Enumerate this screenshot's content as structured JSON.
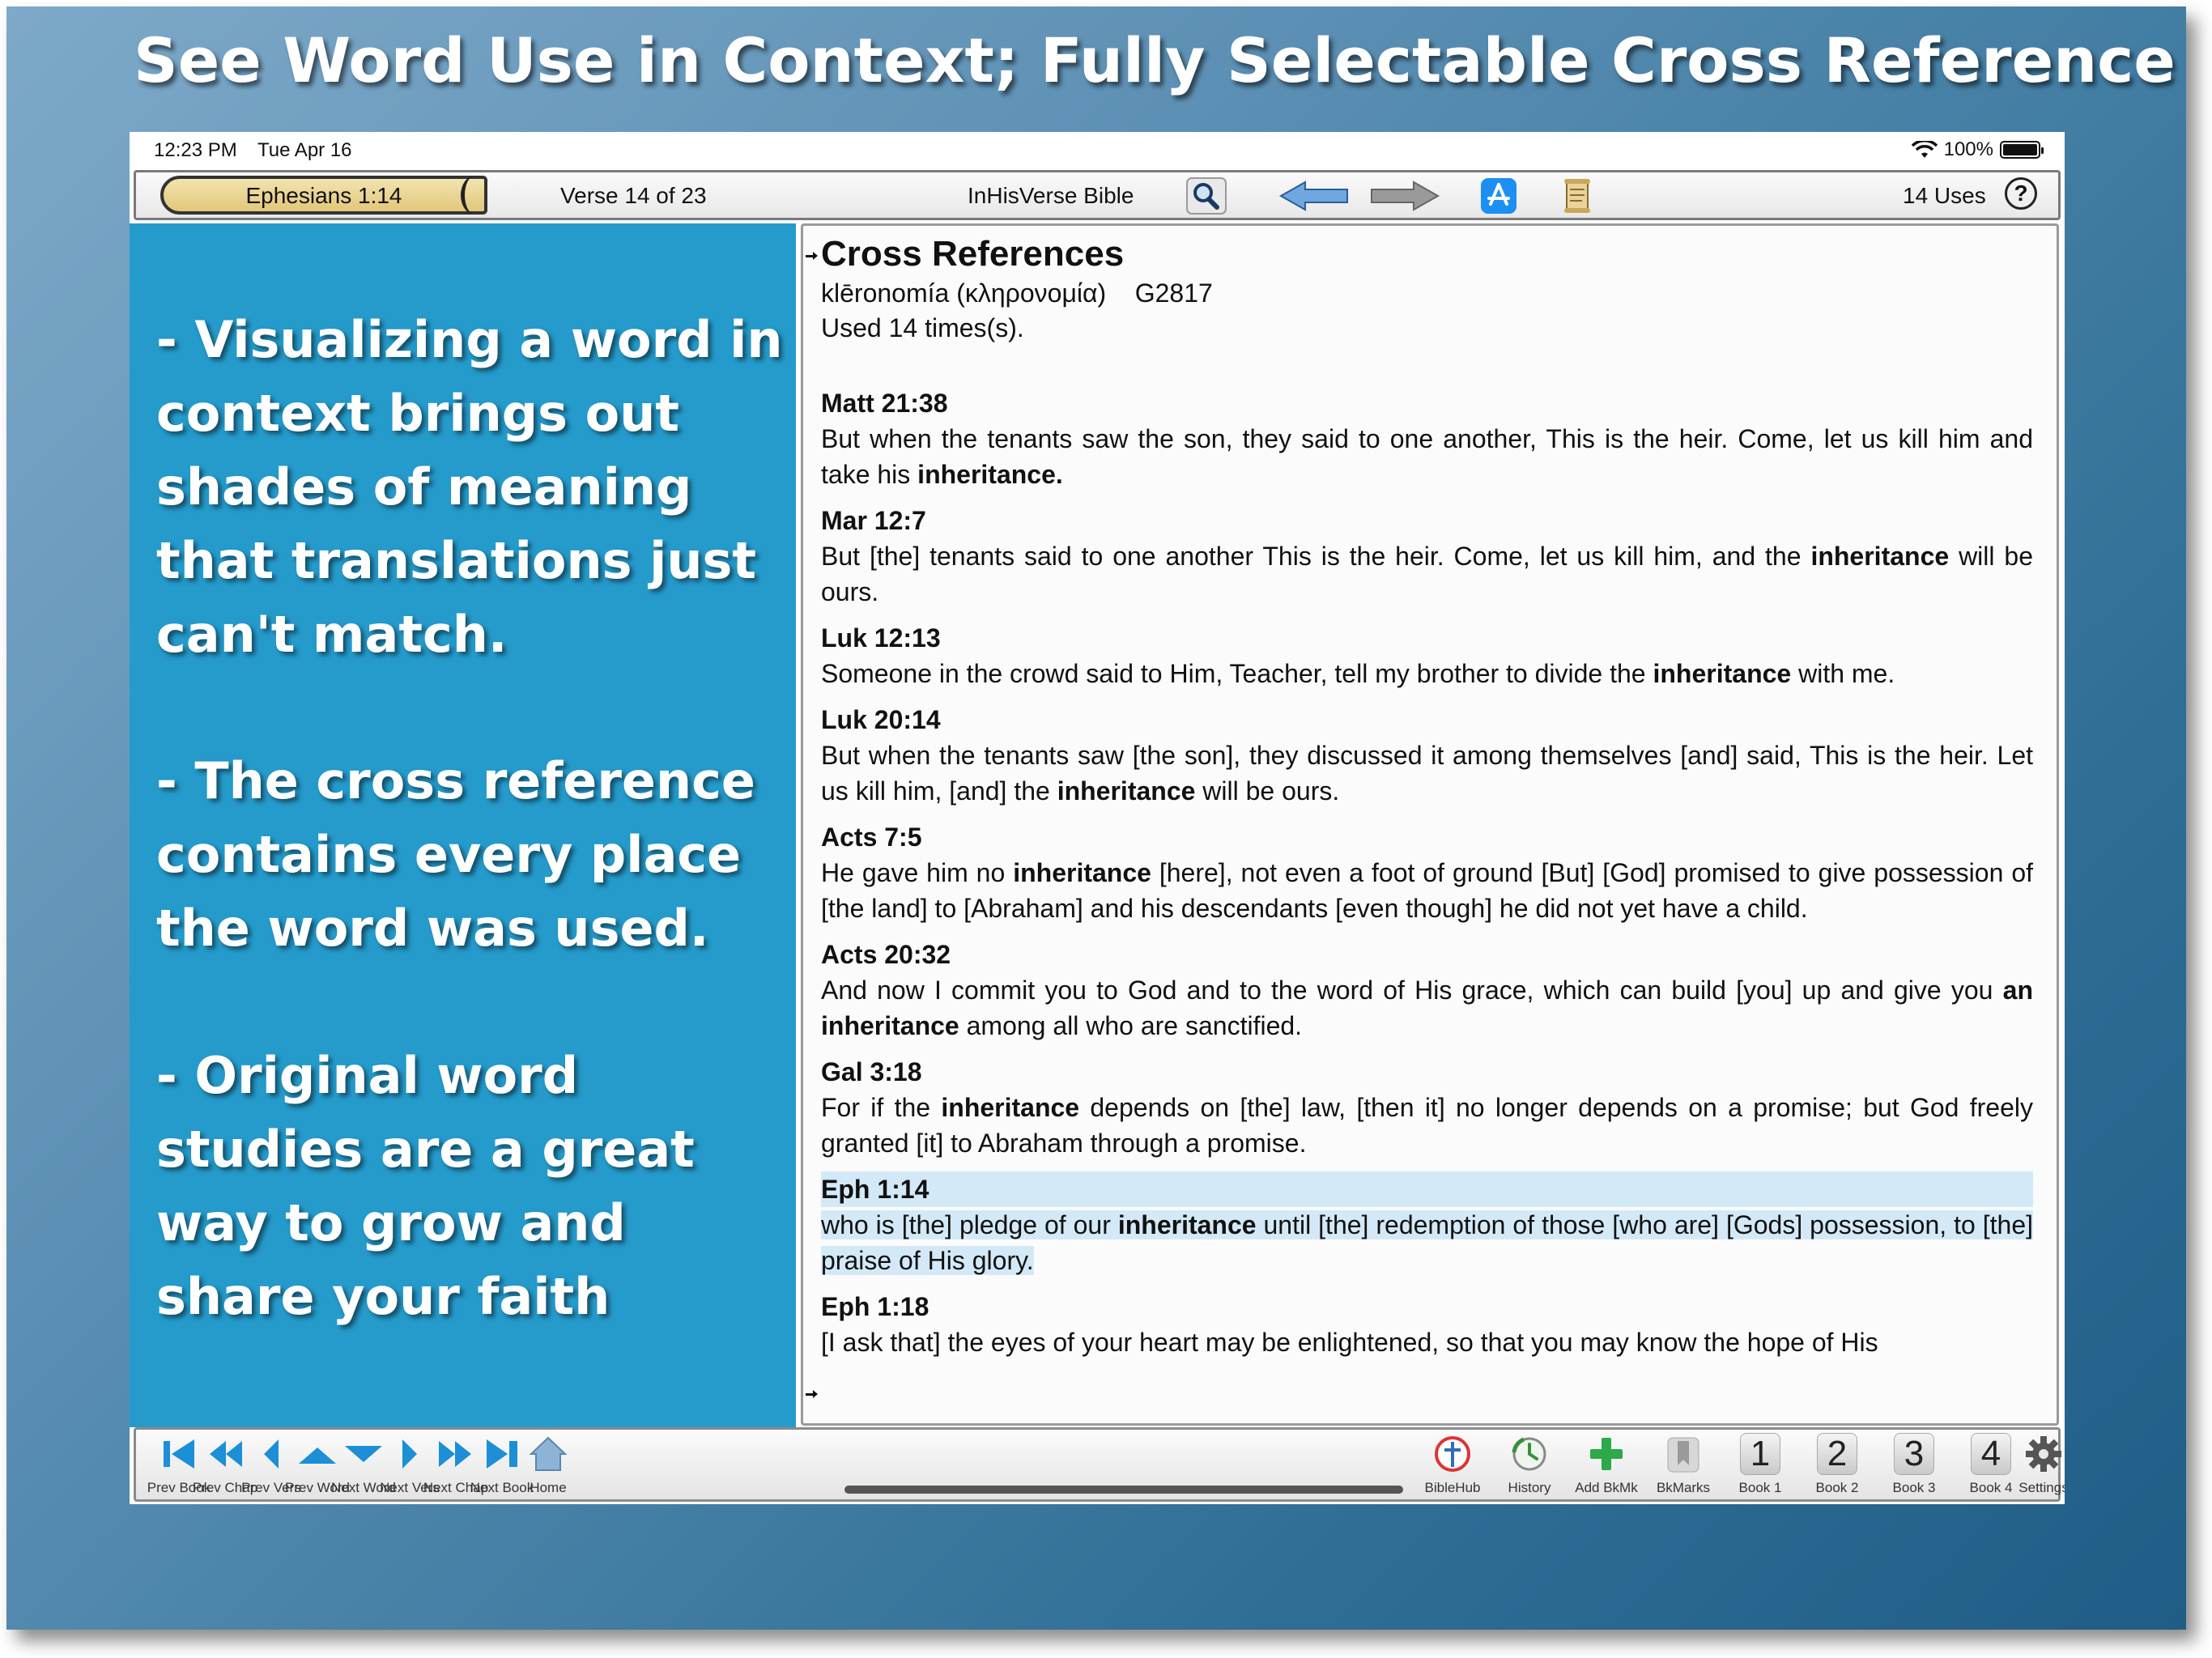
{
  "headline": "See Word Use in Context; Fully Selectable Cross Reference",
  "status": {
    "time": "12:23 PM",
    "date": "Tue Apr 16",
    "battery": "100%"
  },
  "toolbar": {
    "book_ref": "Ephesians 1:14",
    "verse_of": "Verse 14 of 23",
    "app_title": "InHisVerse Bible",
    "uses": "14 Uses",
    "help": "?",
    "icons": [
      "search-icon",
      "back-arrow-icon",
      "forward-arrow-icon",
      "app-store-icon",
      "scroll-icon"
    ]
  },
  "left_panel": {
    "points": [
      "- Visualizing a word in context brings out shades of meaning that translations just can't match.",
      "- The cross reference contains every place the word was used.",
      "- Original word studies are a great way to grow and share your faith"
    ]
  },
  "content": {
    "heading": "Cross References",
    "word": "klēronomía (κληρονομία)",
    "strongs": "G2817",
    "used": "Used 14 times(s).",
    "entries": [
      {
        "ref": "Matt 21:38",
        "pre": "But when the tenants saw the son, they said to one another, This is the heir. Come, let us kill him and take his ",
        "bold": "inheritance.",
        "post": ""
      },
      {
        "ref": "Mar 12:7",
        "pre": "But [the] tenants said to one another This is the heir. Come, let us kill him, and the ",
        "bold": "inheritance",
        "post": " will be ours."
      },
      {
        "ref": "Luk 12:13",
        "pre": "Someone in the crowd said to Him, Teacher, tell my brother to divide the ",
        "bold": "inheritance",
        "post": " with me."
      },
      {
        "ref": "Luk 20:14",
        "pre": "But when the tenants saw [the son], they discussed it among themselves [and] said, This is the heir. Let us kill him, [and] the ",
        "bold": "inheritance",
        "post": " will be ours."
      },
      {
        "ref": "Acts 7:5",
        "pre": "He gave him no ",
        "bold": "inheritance",
        "post": " [here], not even a foot of ground [But] [God] promised to give possession of [the land] to [Abraham] and his descendants [even though] he did not yet have a child."
      },
      {
        "ref": "Acts 20:32",
        "pre": "And now I commit you to God and to the word of His grace, which can build [you] up and give you ",
        "bold": "an inheritance",
        "post": " among all who are sanctified."
      },
      {
        "ref": "Gal 3:18",
        "pre": "For if the ",
        "bold": "inheritance",
        "post": " depends on [the] law, [then it] no longer depends on a promise; but God freely granted [it] to Abraham through a promise."
      },
      {
        "ref": "Eph 1:14",
        "pre": "who is [the] pledge of our ",
        "bold": "inheritance",
        "post": " until [the] redemption of those [who are] [Gods] possession, to [the] praise of His glory.",
        "highlight": true
      },
      {
        "ref": "Eph 1:18",
        "pre": "[I ask that] the eyes of your heart may be enlightened, so that you may know the hope of His",
        "bold": "",
        "post": ""
      }
    ]
  },
  "bottombar": {
    "prev_book": "Prev Book",
    "prev_chap": "Prev Chap",
    "prev_vers": "Prev Vers",
    "prev_word": "Prev Word",
    "next_word": "Next Word",
    "next_vers": "Next Vers",
    "next_chap": "Next Chap",
    "next_book": "Next Book",
    "home": "Home",
    "biblehub": "BibleHub",
    "history": "History",
    "add_bkmk": "Add BkMk",
    "bkmarks": "BkMarks",
    "book1": "Book 1",
    "book1_num": "1",
    "book2": "Book 2",
    "book2_num": "2",
    "book3": "Book 3",
    "book3_num": "3",
    "book4": "Book 4",
    "book4_num": "4",
    "settings": "Settings"
  },
  "colors": {
    "accent": "#259bcc",
    "nav_blue": "#1c8fd6",
    "highlight": "#d3e9f7"
  }
}
